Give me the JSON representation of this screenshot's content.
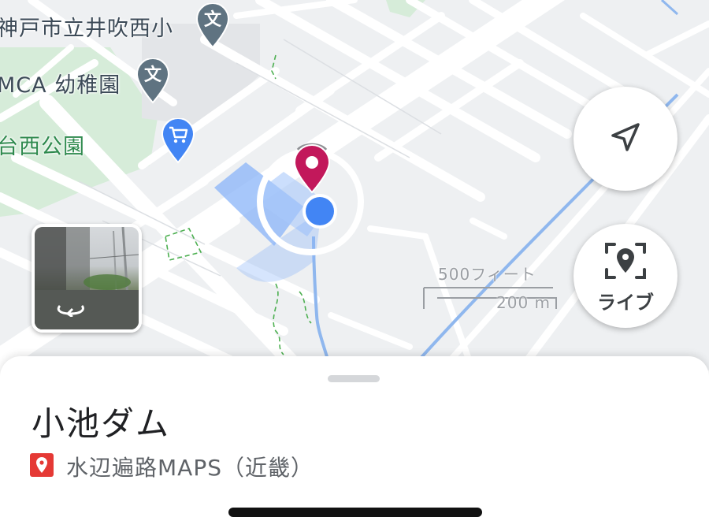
{
  "map": {
    "labels": {
      "school_1": "神戸市立井吹西小",
      "kindergarten": "MCA 幼稚園",
      "park": "台西公園"
    },
    "poi_icons": {
      "school_1": "school-pin-icon",
      "school_2": "school-pin-icon",
      "shopping": "shopping-cart-pin-icon",
      "selected_place": "red-place-pin-icon",
      "my_location": "blue-location-dot-icon"
    },
    "school_glyph": "文",
    "scale": {
      "imperial": "500フィート",
      "metric": "200 m"
    },
    "colors": {
      "map_background": "#eef0f2",
      "road": "#ffffff",
      "park_green": "#d6ecd9",
      "river_blue": "#8fb7ee",
      "building_blue": "#8ab4f8",
      "school_pin": "#5f7381",
      "shopping_pin": "#4285f4",
      "selected_pin": "#c2185b",
      "location_dot": "#4285f4"
    }
  },
  "controls": {
    "navigate_button_icon": "navigation-arrow-icon",
    "live_button": {
      "icon": "live-view-pin-icon",
      "label": "ライブ"
    },
    "street_view": {
      "icon": "rotate-360-icon"
    }
  },
  "sheet": {
    "title": "小池ダム",
    "source_icon": "red-place-pin-icon",
    "source": "水辺遍路MAPS（近畿）"
  }
}
